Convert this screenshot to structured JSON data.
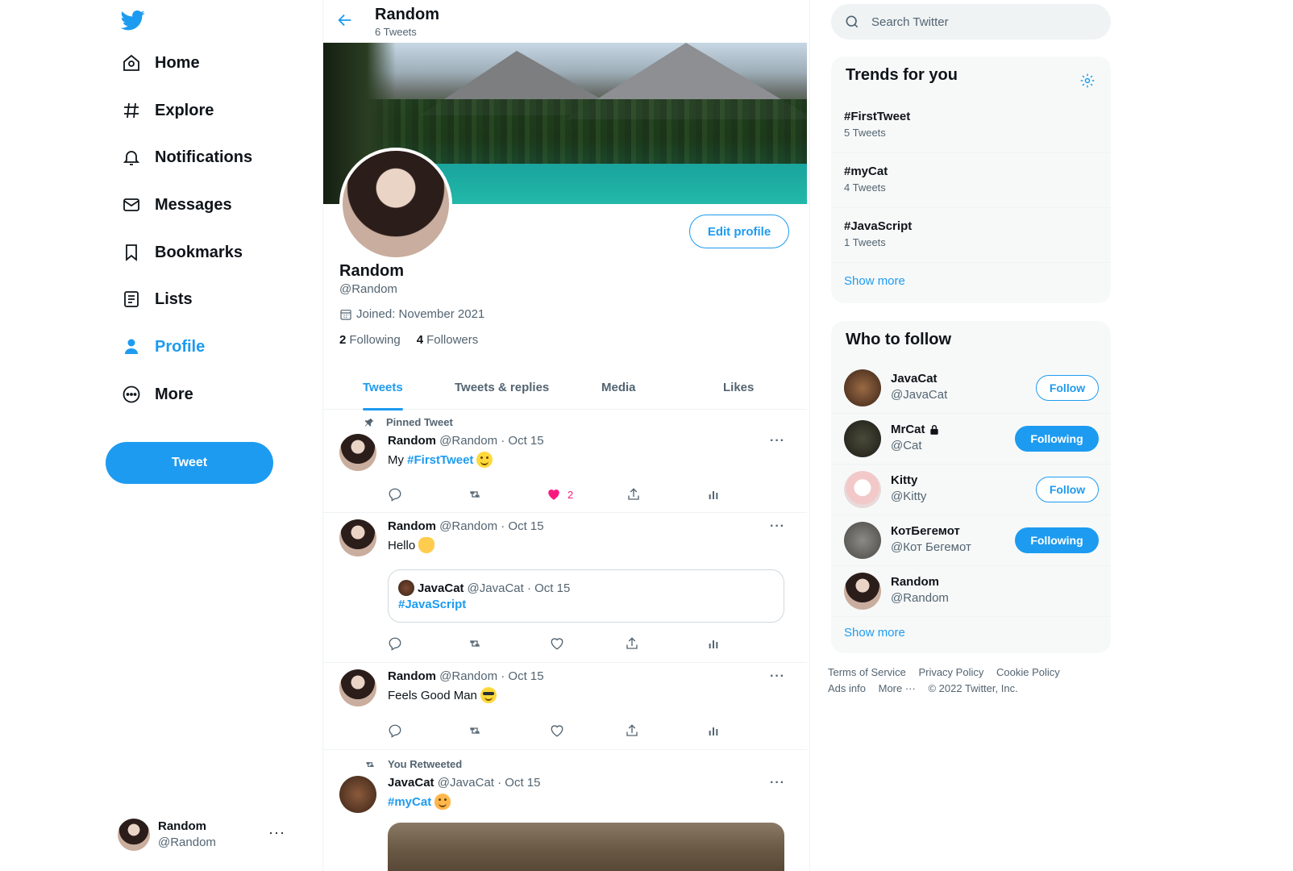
{
  "nav": {
    "items": [
      {
        "label": "Home",
        "icon": "home-icon"
      },
      {
        "label": "Explore",
        "icon": "hashtag-icon"
      },
      {
        "label": "Notifications",
        "icon": "bell-icon"
      },
      {
        "label": "Messages",
        "icon": "envelope-icon"
      },
      {
        "label": "Bookmarks",
        "icon": "bookmark-icon"
      },
      {
        "label": "Lists",
        "icon": "list-icon"
      },
      {
        "label": "Profile",
        "icon": "person-icon",
        "active": true
      },
      {
        "label": "More",
        "icon": "more-circle-icon"
      }
    ],
    "tweet_button": "Tweet",
    "account": {
      "name": "Random",
      "handle": "@Random",
      "more": "···"
    }
  },
  "header": {
    "title": "Random",
    "tweet_count": "6 Tweets"
  },
  "profile": {
    "name": "Random",
    "handle": "@Random",
    "joined": "Joined: November 2021",
    "following_count": "2",
    "following_label": "Following",
    "followers_count": "4",
    "followers_label": "Followers",
    "edit_button": "Edit profile"
  },
  "tabs": [
    "Tweets",
    "Tweets & replies",
    "Media",
    "Likes"
  ],
  "tweets": [
    {
      "context": "Pinned Tweet",
      "name": "Random",
      "meta": "@Random · Oct 15",
      "text": "My ",
      "hashtag": "#FirstTweet",
      "emoji": "smile",
      "likes": "2"
    },
    {
      "name": "Random",
      "meta": "@Random · Oct 15",
      "text": "Hello",
      "emoji": "wave",
      "quote": {
        "name": "JavaCat",
        "meta": "@JavaCat · Oct 15",
        "text": "#JavaScript"
      }
    },
    {
      "name": "Random",
      "meta": "@Random · Oct 15",
      "text": "Feels Good Man",
      "emoji": "sunglasses"
    },
    {
      "context": "You Retweeted",
      "name": "JavaCat",
      "meta": "@JavaCat · Oct 15",
      "hashtag": "#myCat",
      "emoji": "kissing-cat"
    }
  ],
  "search": {
    "placeholder": "Search Twitter"
  },
  "trends": {
    "title": "Trends for you",
    "items": [
      {
        "name": "#FirstTweet",
        "count": "5 Tweets"
      },
      {
        "name": "#myCat",
        "count": "4 Tweets"
      },
      {
        "name": "#JavaScript",
        "count": "1 Tweets"
      }
    ],
    "show_more": "Show more"
  },
  "who_to_follow": {
    "title": "Who to follow",
    "items": [
      {
        "name": "JavaCat",
        "handle": "@JavaCat",
        "button": "Follow"
      },
      {
        "name": "MrCat",
        "handle": "@Cat",
        "button": "Following",
        "locked": true
      },
      {
        "name": "Kitty",
        "handle": "@Kitty",
        "button": "Follow"
      },
      {
        "name": "КотБегемот",
        "handle": "@Кот Бегемот",
        "button": "Following"
      },
      {
        "name": "Random",
        "handle": "@Random"
      }
    ],
    "show_more": "Show more"
  },
  "footer": {
    "links": [
      "Terms of Service",
      "Privacy Policy",
      "Cookie Policy",
      "Ads info",
      "More ···"
    ],
    "copyright": "© 2022 Twitter, Inc."
  },
  "colors": {
    "accent": "#1d9bf0",
    "like": "#f91880",
    "text": "#0f1419",
    "muted": "#536471"
  }
}
